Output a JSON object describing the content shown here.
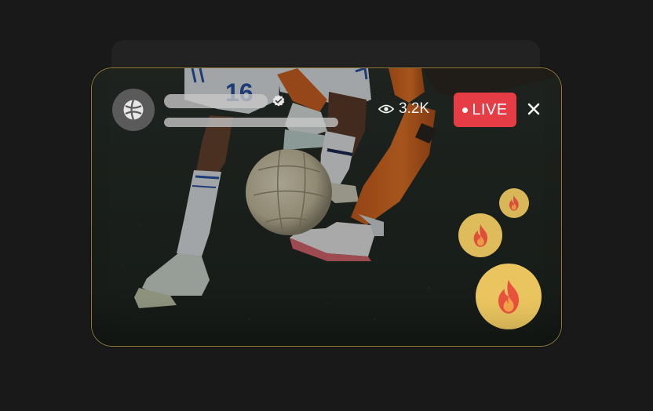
{
  "stream": {
    "viewer_count": "3.2K",
    "live_label": "LIVE",
    "jersey_number": "16"
  },
  "icons": {
    "avatar": "sports-ball-icon",
    "verified": "verified-badge-icon",
    "viewers": "eye-icon",
    "close": "close-icon",
    "reaction": "fire-icon"
  },
  "colors": {
    "live_badge": "#e53c45",
    "card_border": "#d9b44e",
    "reaction_bubble": "#e9c45f"
  }
}
